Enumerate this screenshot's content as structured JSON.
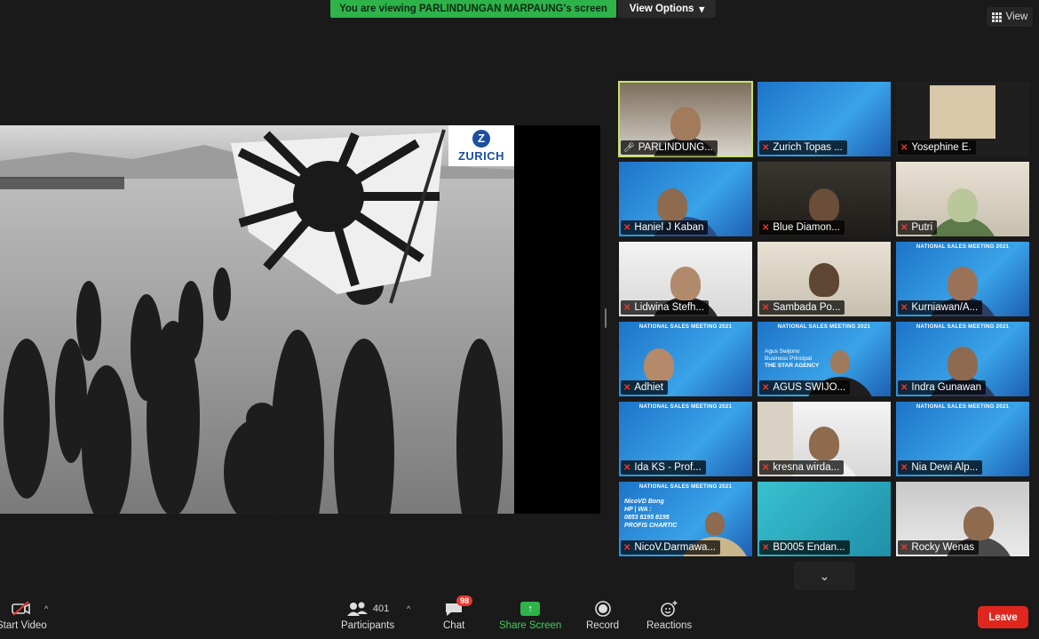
{
  "banner": {
    "text": "You are viewing PARLINDUNGAN MARPAUNG's screen"
  },
  "view_options": {
    "label": "View Options",
    "chevron": "▾"
  },
  "view_button": {
    "label": "View"
  },
  "shared_slide": {
    "logo_text": "ZURICH",
    "logo_mark": "Z"
  },
  "participants_grid": [
    {
      "name": "PARLINDUNG...",
      "mic": "on",
      "active": true
    },
    {
      "name": "Zurich Topas ...",
      "mic": "muted"
    },
    {
      "name": "Yosephine E.",
      "mic": "muted"
    },
    {
      "name": "Haniel J Kaban",
      "mic": "muted"
    },
    {
      "name": "Blue Diamon...",
      "mic": "muted"
    },
    {
      "name": "Putri",
      "mic": "muted"
    },
    {
      "name": "Lidwina Stefh...",
      "mic": "muted"
    },
    {
      "name": "Sambada Po...",
      "mic": "muted"
    },
    {
      "name": "Kurniawan/A...",
      "mic": "muted"
    },
    {
      "name": "Adhiet",
      "mic": "muted"
    },
    {
      "name": "AGUS SWIJO...",
      "mic": "muted"
    },
    {
      "name": "Indra Gunawan",
      "mic": "muted"
    },
    {
      "name": "Ida KS -  Prof...",
      "mic": "muted"
    },
    {
      "name": "kresna wirda...",
      "mic": "muted"
    },
    {
      "name": "Nia Dewi Alp...",
      "mic": "muted"
    },
    {
      "name": "NicoV.Darmawa...",
      "mic": "muted"
    },
    {
      "name": "BD005 Endan...",
      "mic": "muted"
    },
    {
      "name": "Rocky Wenas",
      "mic": "muted"
    }
  ],
  "tile_texts": {
    "meeting_banner": "NATIONAL SALES MEETING",
    "meeting_year": "2021",
    "agus_line1": "Agus Swijono",
    "agus_line2": "Business Principal",
    "agus_line3": "THE STAR AGENCY",
    "nico_line1": "NicoVD Bong",
    "nico_line2": "HP | WA :",
    "nico_line3": "0853 8195 8195",
    "nico_line4": "PROFIS CHARTIC"
  },
  "toolbar": {
    "start_video": "Start Video",
    "participants": "Participants",
    "participants_count": "401",
    "chat": "Chat",
    "chat_badge": "98",
    "share_screen": "Share Screen",
    "record": "Record",
    "reactions": "Reactions",
    "leave": "Leave"
  },
  "colors": {
    "share_green": "#2db34a",
    "leave_red": "#e0271f",
    "active_border": "#c7e26b",
    "muted_red": "#e8382f"
  }
}
